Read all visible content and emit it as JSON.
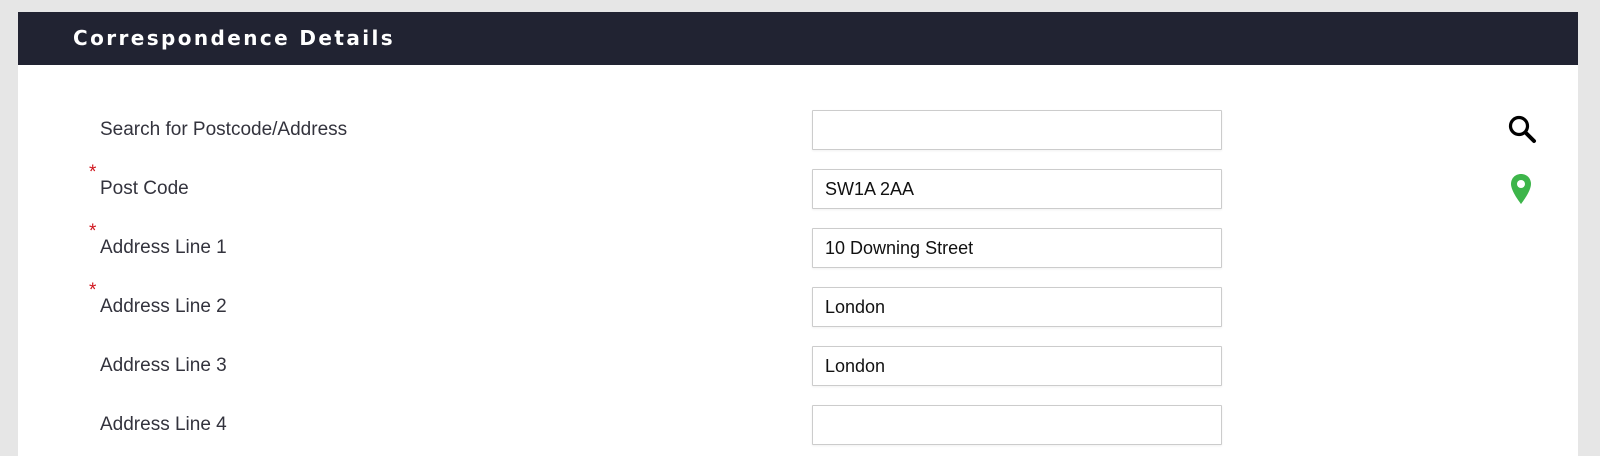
{
  "panel": {
    "title": "Correspondence Details"
  },
  "icons": {
    "search": "search-icon",
    "location": "map-pin-icon"
  },
  "colors": {
    "header_bg": "#212332",
    "required_marker": "#d0161e",
    "pin_green": "#3db54a"
  },
  "required_marker": "*",
  "fields": [
    {
      "label": "Search for Postcode/Address",
      "value": "",
      "placeholder": "",
      "required": false
    },
    {
      "label": "Post Code",
      "value": "SW1A 2AA",
      "placeholder": "",
      "required": true
    },
    {
      "label": "Address Line 1",
      "value": "10 Downing Street",
      "placeholder": "",
      "required": true
    },
    {
      "label": "Address Line 2",
      "value": "London",
      "placeholder": "",
      "required": true
    },
    {
      "label": "Address Line 3",
      "value": "London",
      "placeholder": "",
      "required": false
    },
    {
      "label": "Address Line 4",
      "value": "",
      "placeholder": "",
      "required": false
    }
  ]
}
